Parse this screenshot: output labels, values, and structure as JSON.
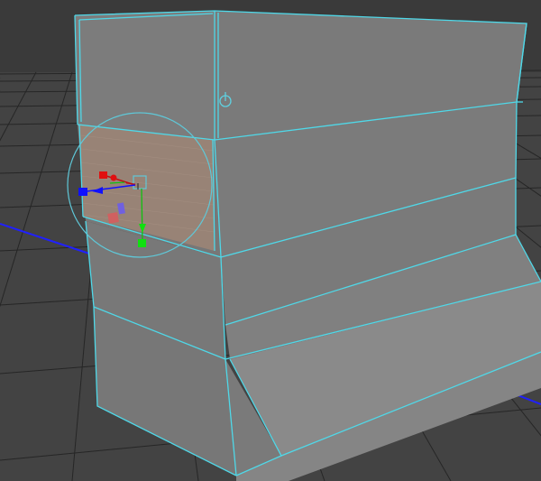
{
  "viewport": {
    "background_sky": "#3a3a3a",
    "background_ground": "#4a4a4a",
    "grid_color": "#1e1e1e",
    "axis_color": "#1a1aff"
  },
  "model": {
    "face_color": "#7d7d7d",
    "face_dark": "#6f6f6f",
    "face_light": "#8a8a8a",
    "wire_color": "#4fd8e8",
    "selected_face_color": "#9b8476"
  },
  "manipulator": {
    "type": "universal",
    "x_axis_color": "#e01010",
    "y_axis_color": "#10e010",
    "z_axis_color": "#1010ff",
    "ring_color": "#5fc8d8"
  },
  "pivot": {
    "icon": "pivot-circle-icon"
  }
}
